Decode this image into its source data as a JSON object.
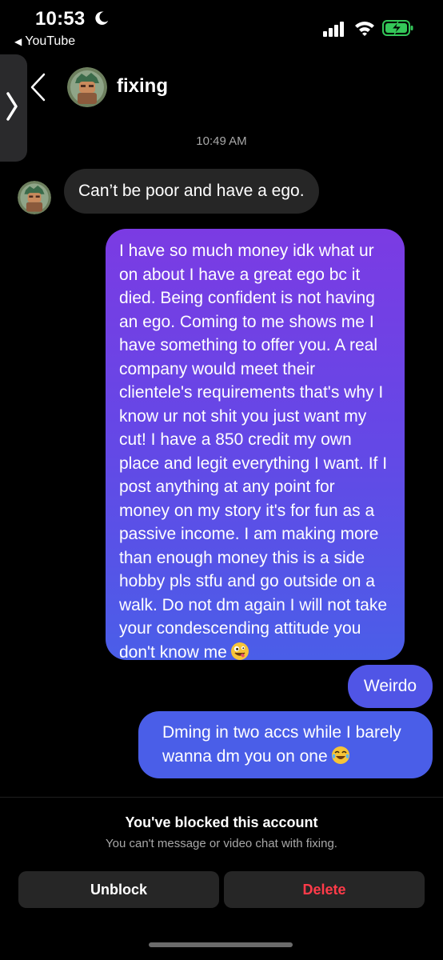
{
  "status_bar": {
    "time": "10:53",
    "back_app": "YouTube"
  },
  "header": {
    "contact_name": "fixing"
  },
  "thread": {
    "timestamp": "10:49 AM",
    "incoming": [
      {
        "text": "Can’t be poor and have a ego."
      }
    ],
    "outgoing": [
      {
        "text": "I have so much money idk what ur\non about I have a great ego bc it\ndied. Being confident is not having\nan ego. Coming to me shows me I\nhave something to offer you. A real\ncompany would meet their\nclientele's requirements that's why I\nknow ur not shit you just want my\ncut! I have a 850 credit my own\nplace and legit everything I want. If I\npost anything at any point for\nmoney on my story it's for fun as a\npassive income. I am making more\nthan enough money this is a side\nhobby pls stfu and go outside on a\nwalk. Do not dm again I will not take\nyour condescending attitude you\ndon't know me",
        "emoji": "zany-face"
      },
      {
        "text": "Weirdo"
      },
      {
        "line1": "Dming in two accs while I barely",
        "line2": "wanna dm you on one",
        "emoji": "tears-of-joy"
      }
    ]
  },
  "blocked": {
    "title": "You've blocked this account",
    "subtitle": "You can't message or video chat with fixing.",
    "unblock_label": "Unblock",
    "delete_label": "Delete"
  },
  "colors": {
    "background": "#000000",
    "incoming_bubble": "#262626",
    "outgoing_gradient_top": "#7b3be3",
    "outgoing_gradient_bottom": "#4a5ee8",
    "delete_red": "#ff3b49",
    "battery_green": "#34c759"
  }
}
